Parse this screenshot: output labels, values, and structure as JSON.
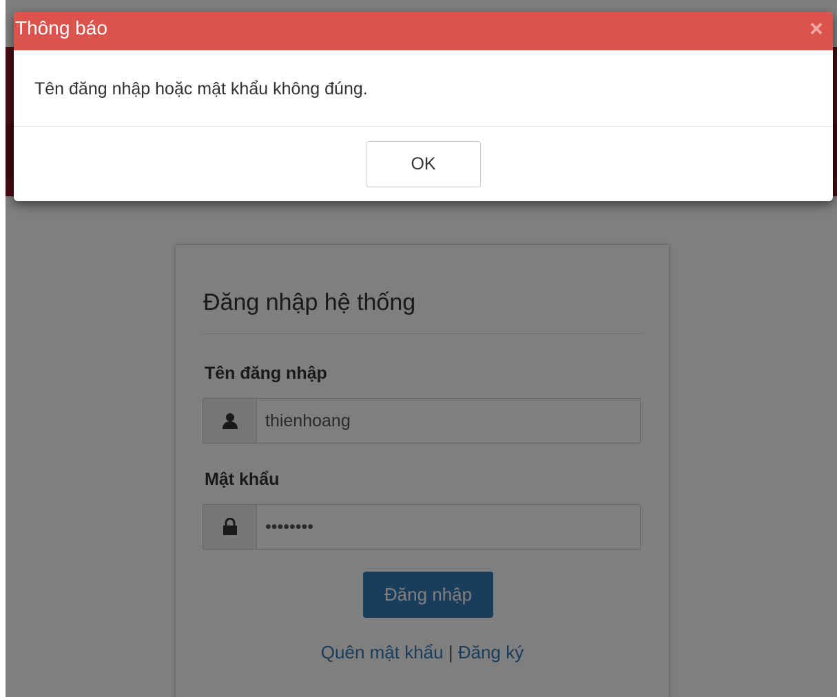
{
  "modal": {
    "title": "Thông báo",
    "close_glyph": "×",
    "message": "Tên đăng nhập hoặc mật khẩu không đúng.",
    "ok_label": "OK",
    "header_color": "#dc534d"
  },
  "login": {
    "title": "Đăng nhập hệ thống",
    "username_label": "Tên đăng nhập",
    "username_value": "thienhoang",
    "username_icon": "user-icon",
    "password_label": "Mật khẩu",
    "password_value": "thienhoa",
    "password_icon": "lock-icon",
    "submit_label": "Đăng nhập",
    "forgot_link": "Quên mật khẩu",
    "link_separator": "|",
    "register_link": "Đăng ký",
    "button_color": "#337ab7"
  }
}
